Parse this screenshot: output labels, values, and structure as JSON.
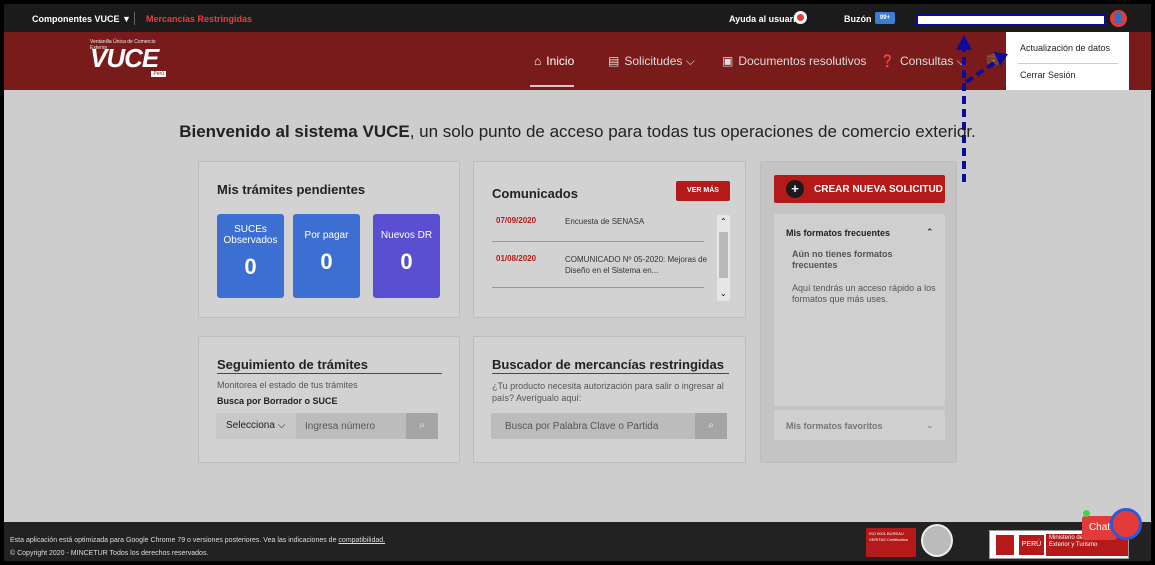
{
  "topbar": {
    "componentes": "Componentes VUCE ▼",
    "mercancias": "Mercancías Restringidas",
    "ayuda": "Ayuda al usuario",
    "buzon": "Buzón",
    "buzon_count": "99+"
  },
  "nav": {
    "logo_small": "Ventanilla Única de Comercio Exterior",
    "logo": "VUCE",
    "logo_peru": "Perú",
    "inicio": "Inicio",
    "solicitudes": "Solicitudes ⌵",
    "documentos": "Documentos resolutivos",
    "consultas": "Consultas ⌵"
  },
  "dropdown": {
    "item1": "Actualización de datos",
    "item2": "Cerrar Sesión"
  },
  "welcome": {
    "bold": "Bienvenido al sistema VUCE",
    "rest": ", un solo punto de acceso para todas tus operaciones de comercio exterior."
  },
  "pendientes": {
    "title": "Mis trámites pendientes",
    "tiles": [
      {
        "label": "SUCEs Observados",
        "value": "0",
        "color": "#3d6fd3"
      },
      {
        "label": "Por pagar",
        "value": "0",
        "color": "#3d6fd3"
      },
      {
        "label": "Nuevos DR",
        "value": "0",
        "color": "#5a4fd1"
      }
    ]
  },
  "comunicados": {
    "title": "Comunicados",
    "ver_mas": "VER MÁS",
    "items": [
      {
        "date": "07/09/2020",
        "text": "Encuesta de SENASA"
      },
      {
        "date": "01/08/2020",
        "text": "COMUNICADO Nº 05-2020: Mejoras de Diseño en el Sistema en..."
      }
    ]
  },
  "crear": {
    "label": "CREAR NUEVA SOLICITUD",
    "frecuentes_title": "Mis formatos frecuentes",
    "no_formatos": "Aún no tienes formatos frecuentes",
    "aqui": "Aquí tendrás un acceso rápido a los formatos que más uses.",
    "favoritos": "Mis formatos favoritos"
  },
  "seguimiento": {
    "title": "Seguimiento de trámites",
    "subtitle": "Monitorea el estado de tus trámites",
    "busca": "Busca por Borrador o SUCE",
    "select": "Selecciona ⌵",
    "placeholder": "Ingresa número"
  },
  "buscador": {
    "title": "Buscador de mercancías restringidas",
    "desc": "¿Tu producto necesita autorización para salir o ingresar al país? Averígualo aquí:",
    "placeholder": "Busca por Palabra Clave o Partida"
  },
  "footer": {
    "line1": "Esta aplicación está optimizada para Google Chrome 79 o versiones posteriores. Vea las indicaciones de",
    "link": "compatibilidad.",
    "line2": "© Copyright 2020 - MINCETUR Todos los derechos reservados.",
    "bv": "ISO 9001 BUREAU VERITAS Certification",
    "peru": "PERÚ",
    "ministerio": "Ministerio de Comercio Exterior y Turismo"
  },
  "chat": {
    "label": "Chat"
  }
}
